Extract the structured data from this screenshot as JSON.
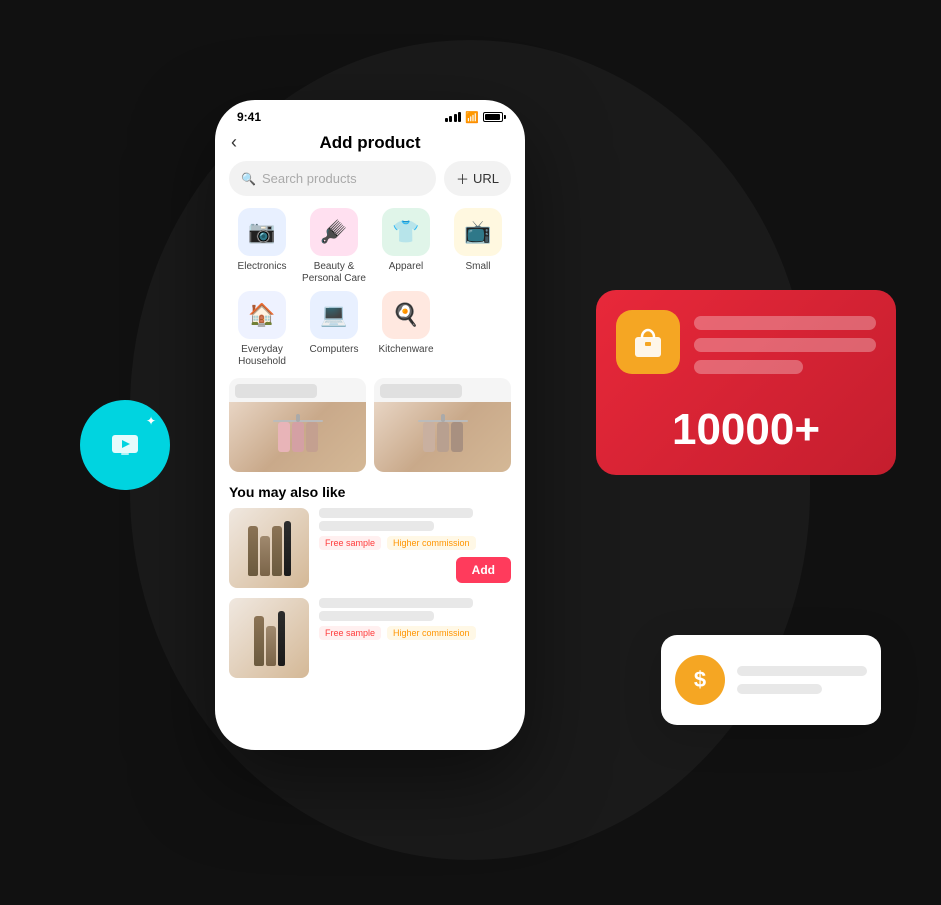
{
  "scene": {
    "background": "#111"
  },
  "status_bar": {
    "time": "9:41",
    "signal": "signal",
    "wifi": "wifi",
    "battery": "battery"
  },
  "header": {
    "back_label": "‹",
    "title": "Add product"
  },
  "search": {
    "placeholder": "Search products",
    "url_label": "+ URL"
  },
  "categories": [
    {
      "id": "electronics",
      "icon": "📷",
      "label": "Electronics",
      "color": "#e8f0ff"
    },
    {
      "id": "beauty",
      "icon": "🪞",
      "label": "Beauty & Personal Care",
      "color": "#ffe0f0"
    },
    {
      "id": "apparel",
      "icon": "👕",
      "label": "Apparel",
      "color": "#e0f5e9"
    },
    {
      "id": "small",
      "icon": "📺",
      "label": "Small",
      "color": "#fff8e0"
    },
    {
      "id": "household",
      "icon": "🏠",
      "label": "Everyday Household",
      "color": "#e8f0ff"
    },
    {
      "id": "computers",
      "icon": "💻",
      "label": "Computers",
      "color": "#e8f0ff"
    },
    {
      "id": "kitchenware",
      "icon": "🍳",
      "label": "Kitchenware",
      "color": "#ffe8e0"
    }
  ],
  "section_you_may_like": {
    "title": "You may also like"
  },
  "product_items": [
    {
      "id": "p1",
      "badge_free": "Free sample",
      "badge_commission": "Higher commission",
      "add_label": "Add"
    },
    {
      "id": "p2",
      "badge_free": "Free sample",
      "badge_commission": "Higher commission"
    }
  ],
  "floating_card_red": {
    "big_number": "10000+"
  },
  "floating_card_white": {},
  "tv_circle": {
    "icon": "▶",
    "sparkle": "✦"
  }
}
